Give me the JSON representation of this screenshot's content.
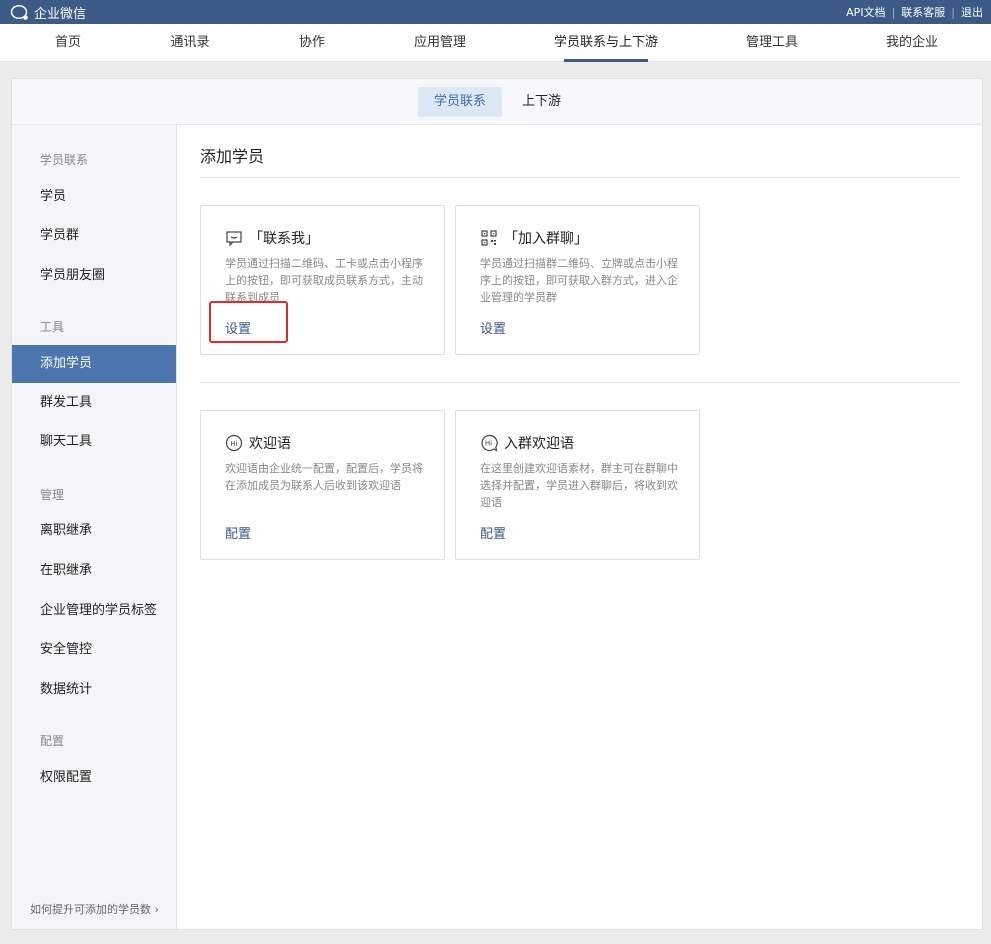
{
  "topbar": {
    "app_name": "企业微信",
    "links": [
      "API文档",
      "联系客服",
      "退出"
    ]
  },
  "nav": {
    "items": [
      "首页",
      "通讯录",
      "协作",
      "应用管理",
      "学员联系与上下游",
      "管理工具",
      "我的企业"
    ],
    "active": "学员联系与上下游"
  },
  "subtabs": {
    "items": [
      "学员联系",
      "上下游"
    ],
    "active": "学员联系"
  },
  "sidebar": {
    "groups": {
      "g1": "学员联系",
      "g2": "工具",
      "g3": "管理",
      "g4": "配置"
    },
    "items": {
      "students": "学员",
      "student_groups": "学员群",
      "moments": "学员朋友圈",
      "add_student": "添加学员",
      "mass_send": "群发工具",
      "chat_tools": "聊天工具",
      "resign_inherit": "离职继承",
      "onjob_inherit": "在职继承",
      "tags": "企业管理的学员标签",
      "security": "安全管控",
      "stats": "数据统计",
      "permissions": "权限配置"
    },
    "active": "添加学员",
    "help": "如何提升可添加的学员数"
  },
  "main": {
    "title": "添加学员",
    "cards": [
      {
        "title": "「联系我」",
        "desc": "学员通过扫描二维码、工卡或点击小程序上的按钮，即可获取成员联系方式，主动联系到成员",
        "action": "设置",
        "icon": "message-icon"
      },
      {
        "title": "「加入群聊」",
        "desc": "学员通过扫描群二维码、立牌或点击小程序上的按钮，即可获取入群方式，进入企业管理的学员群",
        "action": "设置",
        "icon": "qrcode-icon"
      },
      {
        "title": "欢迎语",
        "desc": "欢迎语由企业统一配置，配置后，学员将在添加成员为联系人后收到该欢迎语",
        "action": "配置",
        "icon": "hi-icon"
      },
      {
        "title": "入群欢迎语",
        "desc": "在这里创建欢迎语素材，群主可在群聊中选择并配置，学员进入群聊后，将收到欢迎语",
        "action": "配置",
        "icon": "hi-bubble-icon"
      }
    ]
  },
  "colors": {
    "topbar": "#3b5b86",
    "accent": "#4b76ad",
    "link": "#3b5b86",
    "highlight": "#e02b2b"
  }
}
